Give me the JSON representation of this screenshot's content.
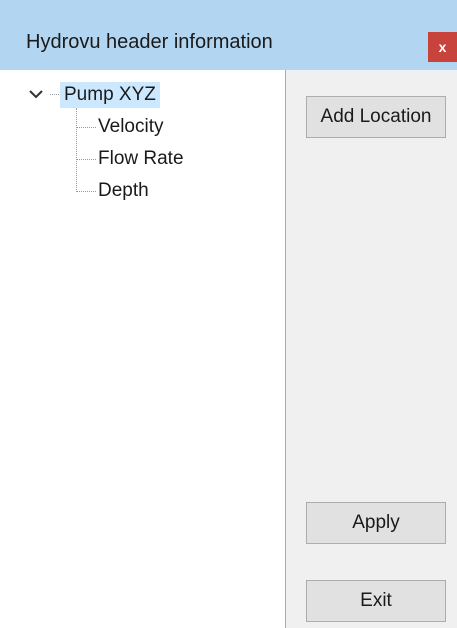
{
  "window": {
    "title": "Hydrovu header information",
    "close_label": "x"
  },
  "tree": {
    "root": {
      "label": "Pump XYZ",
      "expanded": true,
      "selected": true,
      "icon": "chevron-down-icon"
    },
    "children": [
      {
        "label": "Velocity"
      },
      {
        "label": "Flow Rate"
      },
      {
        "label": "Depth"
      }
    ]
  },
  "buttons": {
    "add_location": "Add Location",
    "apply": "Apply",
    "exit": "Exit"
  },
  "colors": {
    "title_bar": "#b2d6f2",
    "close_button": "#c7433b",
    "selection": "#cce8ff",
    "button_face": "#e1e1e1"
  }
}
